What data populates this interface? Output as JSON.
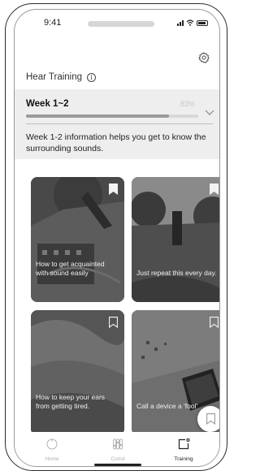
{
  "status_bar": {
    "time": "9:41"
  },
  "header": {
    "title": "Hear Training",
    "info_icon": "info-icon",
    "settings_icon": "gear-icon"
  },
  "week": {
    "title": "Week 1~2",
    "percent_label": "83%",
    "progress": 0.83,
    "description": "Week 1-2 information helps you get to know the surrounding sounds."
  },
  "cards": [
    {
      "label": "How to get acquainted with sound easily",
      "bookmarked": true
    },
    {
      "label": "Just repeat this every day.",
      "bookmarked": true
    },
    {
      "label": "How to keep your ears from getting tired.",
      "bookmarked": false
    },
    {
      "label": "Call a device a 'fool'",
      "bookmarked": false
    }
  ],
  "tabs": [
    {
      "label": "Home",
      "icon": "clock-icon",
      "active": false
    },
    {
      "label": "Cotrol",
      "icon": "control-icon",
      "active": false
    },
    {
      "label": "Training",
      "icon": "training-icon",
      "active": true
    }
  ],
  "colors": {
    "panel": "#eeeeee",
    "accent": "#222222",
    "inactive": "#b0b0b0"
  }
}
